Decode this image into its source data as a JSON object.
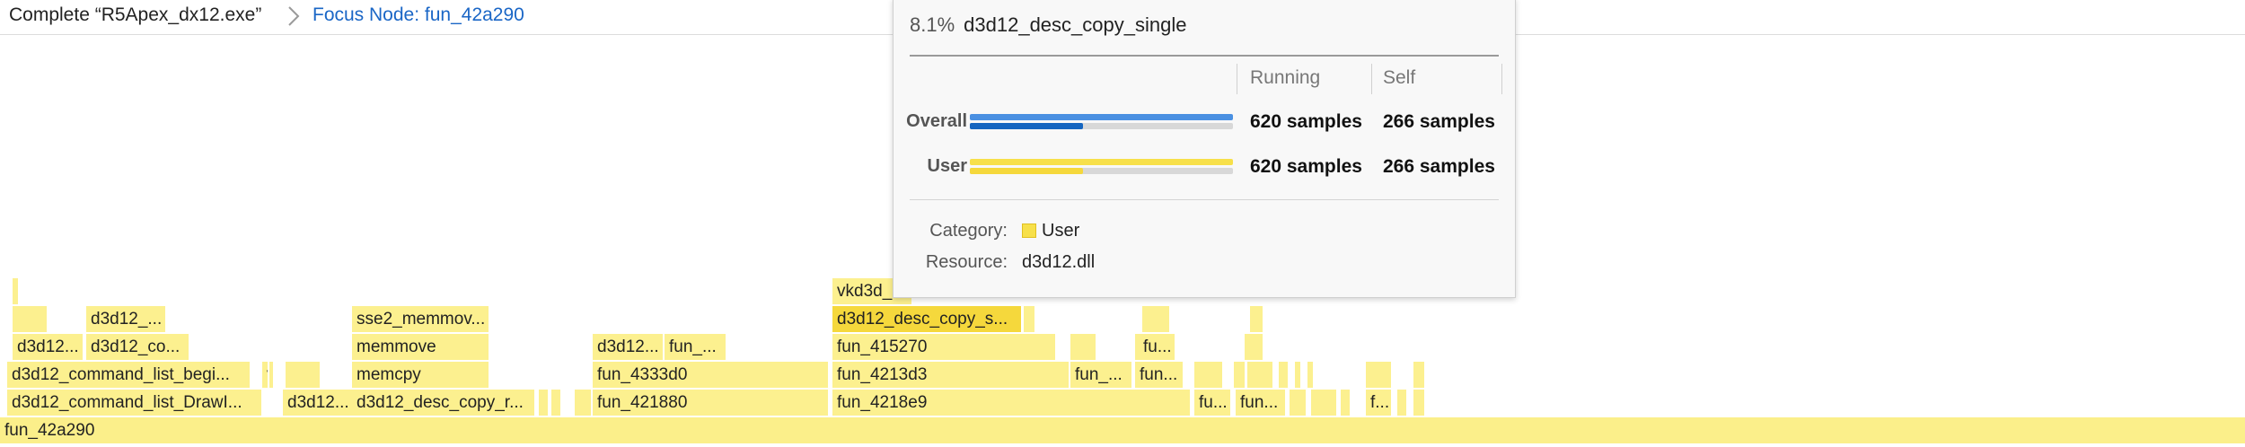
{
  "breadcrumb": {
    "root": "Complete “R5Apex_dx12.exe”",
    "focus": "Focus Node: fun_42a290"
  },
  "flame": {
    "selected_value": "d3d12_desc_copy_single",
    "frames": [
      {
        "label": "fun_42a290",
        "depth": 0
      },
      {
        "label": "d3d12_command_list_DrawI...",
        "depth": 1
      },
      {
        "label": "",
        "depth": 2
      },
      {
        "label": "d3d12...",
        "depth": 1
      },
      {
        "label": "d3d12_desc_copy_r...",
        "depth": 1
      },
      {
        "label": "",
        "depth": 1
      },
      {
        "label": "",
        "depth": 1
      },
      {
        "label": "",
        "depth": 1
      },
      {
        "label": "fun_421880",
        "depth": 1
      },
      {
        "label": "fun_4218e9",
        "depth": 1
      },
      {
        "label": "fu...",
        "depth": 1
      },
      {
        "label": "fun...",
        "depth": 1
      },
      {
        "label": "",
        "depth": 1
      },
      {
        "label": "",
        "depth": 1
      },
      {
        "label": "",
        "depth": 1
      },
      {
        "label": "f...",
        "depth": 1
      },
      {
        "label": "",
        "depth": 1
      },
      {
        "label": "",
        "depth": 1
      },
      {
        "label": "d3d12_command_list_begi...",
        "depth": 2
      },
      {
        "label": "v...",
        "depth": 2
      },
      {
        "label": "",
        "depth": 2
      },
      {
        "label": "memcpy",
        "depth": 2
      },
      {
        "label": "fun_4333d0",
        "depth": 2
      },
      {
        "label": "fun_4213d3",
        "depth": 2
      },
      {
        "label": "fun_...",
        "depth": 2
      },
      {
        "label": "fun...",
        "depth": 2
      },
      {
        "label": "",
        "depth": 2
      },
      {
        "label": "",
        "depth": 2
      },
      {
        "label": "",
        "depth": 2
      },
      {
        "label": "",
        "depth": 2
      },
      {
        "label": "",
        "depth": 2
      },
      {
        "label": "",
        "depth": 2
      },
      {
        "label": "",
        "depth": 2
      },
      {
        "label": "",
        "depth": 2
      },
      {
        "label": "d3d12...",
        "depth": 3
      },
      {
        "label": "d3d12_co...",
        "depth": 3
      },
      {
        "label": "memmove",
        "depth": 3
      },
      {
        "label": "d3d12...",
        "depth": 3
      },
      {
        "label": "fun_...",
        "depth": 3
      },
      {
        "label": "fun_415270",
        "depth": 3
      },
      {
        "label": "",
        "depth": 3
      },
      {
        "label": "",
        "depth": 3
      },
      {
        "label": "fu...",
        "depth": 3
      },
      {
        "label": "",
        "depth": 3
      },
      {
        "label": "",
        "depth": 4
      },
      {
        "label": "d3d12_...",
        "depth": 4
      },
      {
        "label": "sse2_memmov...",
        "depth": 4
      },
      {
        "label": "d3d12_desc_copy_s...",
        "depth": 4
      },
      {
        "label": "",
        "depth": 4
      },
      {
        "label": "",
        "depth": 4
      },
      {
        "label": "",
        "depth": 4
      },
      {
        "label": "",
        "depth": 5
      },
      {
        "label": "vkd3d_",
        "depth": 5
      }
    ]
  },
  "tooltip": {
    "percent": "8.1%",
    "title": "d3d12_desc_copy_single",
    "col_running": "Running",
    "col_self": "Self",
    "rows": [
      {
        "label": "Overall",
        "running": "620 samples",
        "self": "266 samples",
        "running_fraction": 1.0,
        "self_fraction": 0.43
      },
      {
        "label": "User",
        "running": "620 samples",
        "self": "266 samples",
        "running_fraction": 1.0,
        "self_fraction": 0.43
      }
    ],
    "category_label": "Category:",
    "category_value": "User",
    "resource_label": "Resource:",
    "resource_value": "d3d12.dll"
  },
  "colors": {
    "frame": "#fcf08f",
    "selected_frame": "#f5d83c",
    "overall_running": "#4a90e2",
    "overall_self": "#1565c0",
    "user_running": "#f7e04a",
    "user_self": "#f5d83c",
    "breadcrumb_link": "#1a66c6"
  },
  "icons": {
    "breadcrumb_separator": "chevron-right-icon",
    "category_swatch": "category-color-swatch"
  }
}
